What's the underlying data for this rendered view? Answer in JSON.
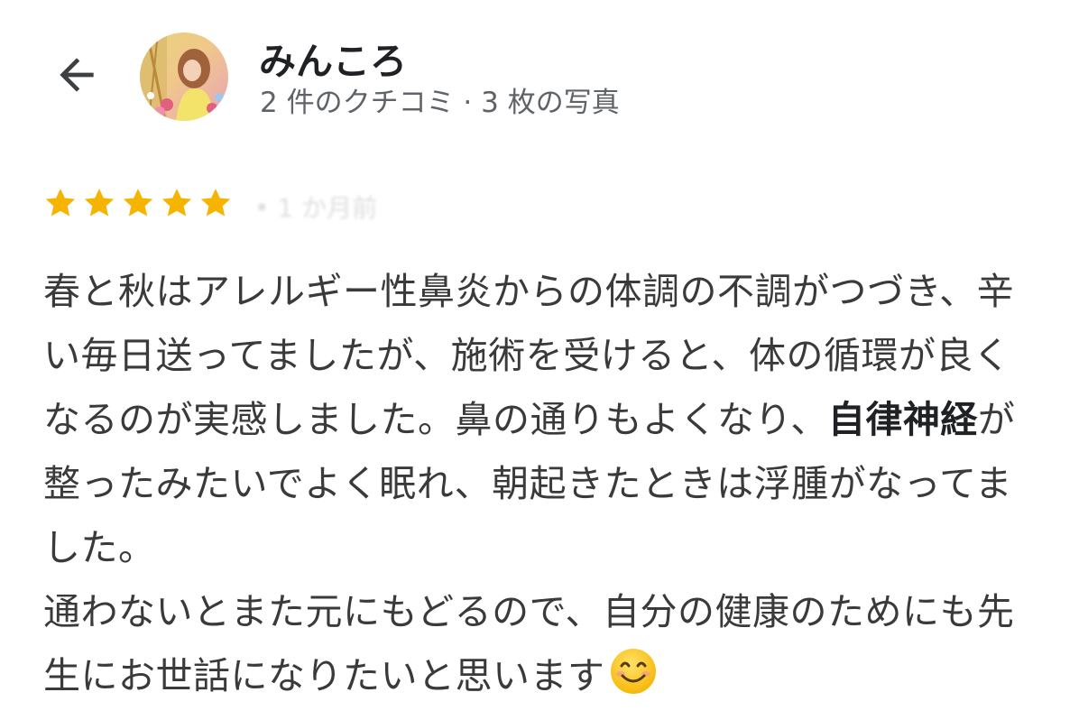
{
  "header": {
    "back_icon": "arrow-left-icon",
    "user_name": "みんころ",
    "user_meta": "2 件のクチコミ · 3 枚の写真"
  },
  "review": {
    "rating": 5,
    "rating_max": 5,
    "star_color": "#f4b400",
    "date_text": "• 1 か月前",
    "paragraph1_part1": "春と秋はアレルギー性鼻炎からの体調の不調がつづき、辛い毎日送ってましたが、施術を受けると、体の循環が良くなるのが実感しました。鼻の通りもよくなり、",
    "paragraph1_bold": "自律神経",
    "paragraph1_part2": "が整ったみたいでよく眠れ、朝起きたときは浮腫がなってました。",
    "paragraph2": "通わないとまた元にもどるので、自分の健康のためにも先生にお世話になりたいと思います",
    "emoji": "smiling-face-icon"
  }
}
